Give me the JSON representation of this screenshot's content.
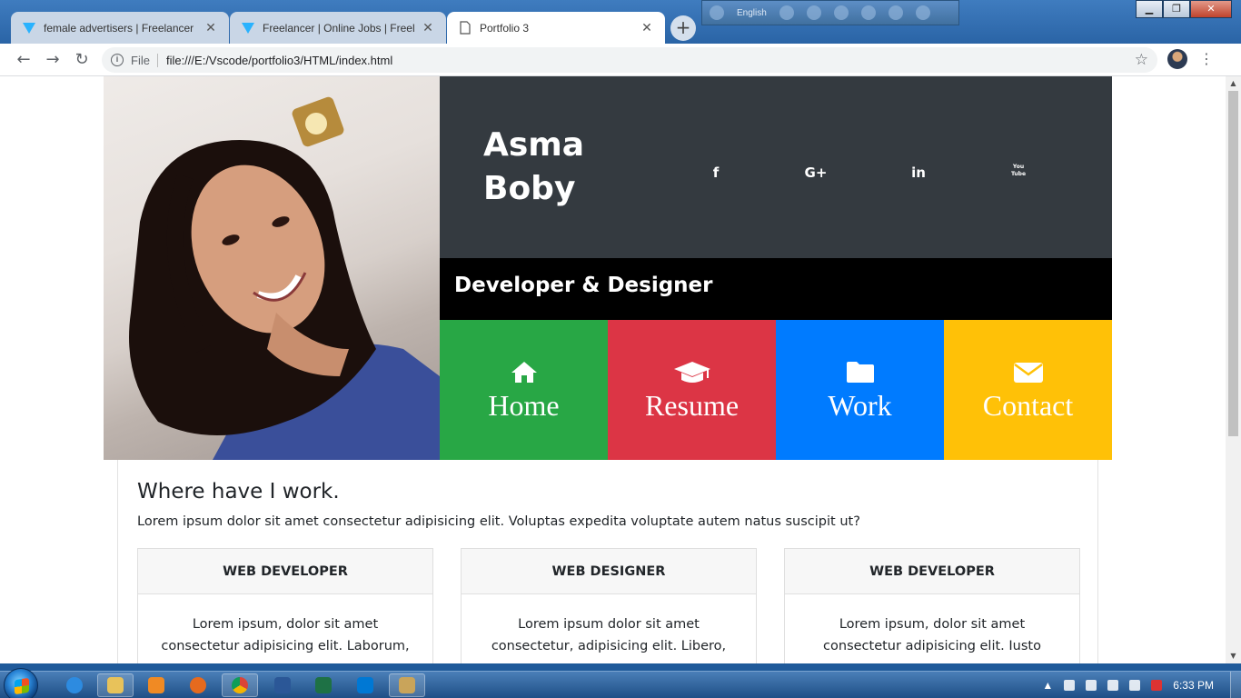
{
  "browser": {
    "tabs": [
      {
        "title": "female advertisers | Freelancer",
        "active": false
      },
      {
        "title": "Freelancer | Online Jobs | Freelance",
        "active": false
      },
      {
        "title": "Portfolio 3",
        "active": true
      }
    ],
    "close_glyph": "✕",
    "new_tab_glyph": "+",
    "url_scheme": "File",
    "url": "file:///E:/Vscode/portfolio3/HTML/index.html",
    "language": "English"
  },
  "portfolio": {
    "name_first": "Asma",
    "name_last": "Boby",
    "tagline": "Developer & Designer",
    "socials": [
      {
        "label": "f",
        "icon": "facebook-icon"
      },
      {
        "label": "G+",
        "icon": "google-plus-icon"
      },
      {
        "label": "in",
        "icon": "linkedin-icon"
      },
      {
        "label": "You Tube",
        "icon": "youtube-icon"
      }
    ],
    "nav": [
      {
        "label": "Home",
        "icon": "home-icon",
        "color": "#28a745"
      },
      {
        "label": "Resume",
        "icon": "graduation-cap-icon",
        "color": "#dc3545"
      },
      {
        "label": "Work",
        "icon": "folder-icon",
        "color": "#007bff"
      },
      {
        "label": "Contact",
        "icon": "envelope-icon",
        "color": "#ffc107"
      }
    ],
    "work_section": {
      "heading": "Where have I work.",
      "lead": "Lorem ipsum dolor sit amet consectetur adipisicing elit. Voluptas expedita voluptate autem natus suscipit ut?",
      "jobs": [
        {
          "title": "WEB DEVELOPER",
          "body": "Lorem ipsum, dolor sit amet consectetur adipisicing elit. Laborum,"
        },
        {
          "title": "WEB DESIGNER",
          "body": "Lorem ipsum dolor sit amet consectetur, adipisicing elit. Libero,"
        },
        {
          "title": "WEB DEVELOPER",
          "body": "Lorem ipsum, dolor sit amet consectetur adipisicing elit. Iusto"
        }
      ]
    }
  },
  "taskbar": {
    "clock": "6:33 PM",
    "apps": [
      "internet-explorer",
      "file-explorer",
      "media-player",
      "firefox",
      "chrome",
      "word",
      "excel",
      "vscode",
      "paint"
    ]
  },
  "colors": {
    "header_dark": "#343a40",
    "tagline_bg": "#000000",
    "home": "#28a745",
    "resume": "#dc3545",
    "work": "#007bff",
    "contact": "#ffc107"
  }
}
